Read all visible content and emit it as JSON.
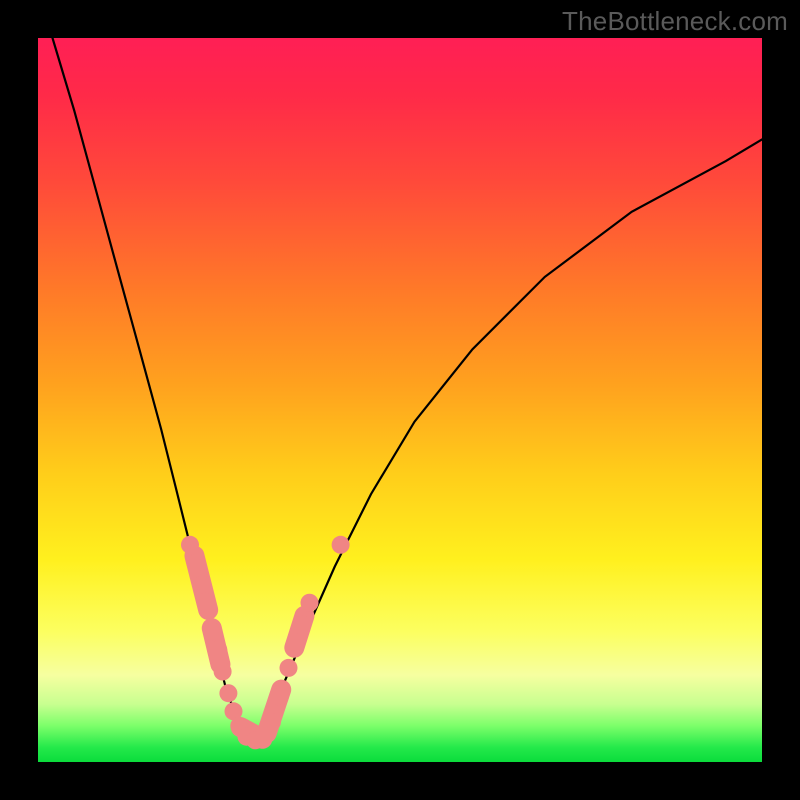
{
  "watermark": "TheBottleneck.com",
  "colors": {
    "background": "#000000",
    "dot": "#f08584",
    "curve": "#000000"
  },
  "chart_data": {
    "type": "line",
    "title": "",
    "xlabel": "",
    "ylabel": "",
    "xlim": [
      0,
      100
    ],
    "ylim": [
      0,
      100
    ],
    "grid": false,
    "legend": false,
    "series": [
      {
        "name": "bottleneck-curve",
        "x": [
          2,
          5,
          8,
          11,
          14,
          17,
          19,
          21,
          23,
          24.5,
          26,
          27.5,
          29,
          30.5,
          32,
          34,
          37,
          41,
          46,
          52,
          60,
          70,
          82,
          95,
          100
        ],
        "y": [
          100,
          90,
          79,
          68,
          57,
          46,
          38,
          30,
          22,
          16,
          10,
          6,
          3,
          3,
          6,
          11,
          18,
          27,
          37,
          47,
          57,
          67,
          76,
          83,
          86
        ]
      }
    ],
    "points_overlay": [
      {
        "x": 21.0,
        "y": 30.0
      },
      {
        "x": 21.8,
        "y": 27.5
      },
      {
        "x": 22.6,
        "y": 24.5
      },
      {
        "x": 23.3,
        "y": 22.0
      },
      {
        "x": 24.2,
        "y": 18.0
      },
      {
        "x": 24.9,
        "y": 15.5
      },
      {
        "x": 25.5,
        "y": 12.5
      },
      {
        "x": 26.3,
        "y": 9.5
      },
      {
        "x": 27.0,
        "y": 7.0
      },
      {
        "x": 27.8,
        "y": 5.0
      },
      {
        "x": 28.8,
        "y": 3.5
      },
      {
        "x": 30.0,
        "y": 3.0
      },
      {
        "x": 31.2,
        "y": 3.5
      },
      {
        "x": 32.3,
        "y": 5.5
      },
      {
        "x": 33.4,
        "y": 9.0
      },
      {
        "x": 34.6,
        "y": 13.0
      },
      {
        "x": 35.6,
        "y": 16.5
      },
      {
        "x": 36.5,
        "y": 19.0
      },
      {
        "x": 37.5,
        "y": 22.0
      },
      {
        "x": 41.8,
        "y": 30.0
      }
    ],
    "pill_clusters": [
      {
        "x1": 21.6,
        "y1": 28.5,
        "x2": 23.5,
        "y2": 21.0
      },
      {
        "x1": 24.0,
        "y1": 18.5,
        "x2": 25.2,
        "y2": 13.5
      },
      {
        "x1": 28.0,
        "y1": 4.8,
        "x2": 31.0,
        "y2": 3.2
      },
      {
        "x1": 31.6,
        "y1": 4.0,
        "x2": 33.6,
        "y2": 10.0
      },
      {
        "x1": 35.4,
        "y1": 15.8,
        "x2": 36.8,
        "y2": 20.2
      }
    ]
  }
}
